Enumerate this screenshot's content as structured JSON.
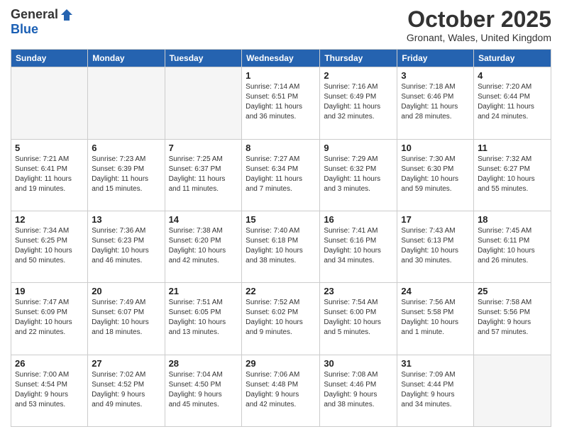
{
  "header": {
    "logo_general": "General",
    "logo_blue": "Blue",
    "month_title": "October 2025",
    "location": "Gronant, Wales, United Kingdom"
  },
  "days_of_week": [
    "Sunday",
    "Monday",
    "Tuesday",
    "Wednesday",
    "Thursday",
    "Friday",
    "Saturday"
  ],
  "weeks": [
    [
      {
        "day": "",
        "info": ""
      },
      {
        "day": "",
        "info": ""
      },
      {
        "day": "",
        "info": ""
      },
      {
        "day": "1",
        "info": "Sunrise: 7:14 AM\nSunset: 6:51 PM\nDaylight: 11 hours\nand 36 minutes."
      },
      {
        "day": "2",
        "info": "Sunrise: 7:16 AM\nSunset: 6:49 PM\nDaylight: 11 hours\nand 32 minutes."
      },
      {
        "day": "3",
        "info": "Sunrise: 7:18 AM\nSunset: 6:46 PM\nDaylight: 11 hours\nand 28 minutes."
      },
      {
        "day": "4",
        "info": "Sunrise: 7:20 AM\nSunset: 6:44 PM\nDaylight: 11 hours\nand 24 minutes."
      }
    ],
    [
      {
        "day": "5",
        "info": "Sunrise: 7:21 AM\nSunset: 6:41 PM\nDaylight: 11 hours\nand 19 minutes."
      },
      {
        "day": "6",
        "info": "Sunrise: 7:23 AM\nSunset: 6:39 PM\nDaylight: 11 hours\nand 15 minutes."
      },
      {
        "day": "7",
        "info": "Sunrise: 7:25 AM\nSunset: 6:37 PM\nDaylight: 11 hours\nand 11 minutes."
      },
      {
        "day": "8",
        "info": "Sunrise: 7:27 AM\nSunset: 6:34 PM\nDaylight: 11 hours\nand 7 minutes."
      },
      {
        "day": "9",
        "info": "Sunrise: 7:29 AM\nSunset: 6:32 PM\nDaylight: 11 hours\nand 3 minutes."
      },
      {
        "day": "10",
        "info": "Sunrise: 7:30 AM\nSunset: 6:30 PM\nDaylight: 10 hours\nand 59 minutes."
      },
      {
        "day": "11",
        "info": "Sunrise: 7:32 AM\nSunset: 6:27 PM\nDaylight: 10 hours\nand 55 minutes."
      }
    ],
    [
      {
        "day": "12",
        "info": "Sunrise: 7:34 AM\nSunset: 6:25 PM\nDaylight: 10 hours\nand 50 minutes."
      },
      {
        "day": "13",
        "info": "Sunrise: 7:36 AM\nSunset: 6:23 PM\nDaylight: 10 hours\nand 46 minutes."
      },
      {
        "day": "14",
        "info": "Sunrise: 7:38 AM\nSunset: 6:20 PM\nDaylight: 10 hours\nand 42 minutes."
      },
      {
        "day": "15",
        "info": "Sunrise: 7:40 AM\nSunset: 6:18 PM\nDaylight: 10 hours\nand 38 minutes."
      },
      {
        "day": "16",
        "info": "Sunrise: 7:41 AM\nSunset: 6:16 PM\nDaylight: 10 hours\nand 34 minutes."
      },
      {
        "day": "17",
        "info": "Sunrise: 7:43 AM\nSunset: 6:13 PM\nDaylight: 10 hours\nand 30 minutes."
      },
      {
        "day": "18",
        "info": "Sunrise: 7:45 AM\nSunset: 6:11 PM\nDaylight: 10 hours\nand 26 minutes."
      }
    ],
    [
      {
        "day": "19",
        "info": "Sunrise: 7:47 AM\nSunset: 6:09 PM\nDaylight: 10 hours\nand 22 minutes."
      },
      {
        "day": "20",
        "info": "Sunrise: 7:49 AM\nSunset: 6:07 PM\nDaylight: 10 hours\nand 18 minutes."
      },
      {
        "day": "21",
        "info": "Sunrise: 7:51 AM\nSunset: 6:05 PM\nDaylight: 10 hours\nand 13 minutes."
      },
      {
        "day": "22",
        "info": "Sunrise: 7:52 AM\nSunset: 6:02 PM\nDaylight: 10 hours\nand 9 minutes."
      },
      {
        "day": "23",
        "info": "Sunrise: 7:54 AM\nSunset: 6:00 PM\nDaylight: 10 hours\nand 5 minutes."
      },
      {
        "day": "24",
        "info": "Sunrise: 7:56 AM\nSunset: 5:58 PM\nDaylight: 10 hours\nand 1 minute."
      },
      {
        "day": "25",
        "info": "Sunrise: 7:58 AM\nSunset: 5:56 PM\nDaylight: 9 hours\nand 57 minutes."
      }
    ],
    [
      {
        "day": "26",
        "info": "Sunrise: 7:00 AM\nSunset: 4:54 PM\nDaylight: 9 hours\nand 53 minutes."
      },
      {
        "day": "27",
        "info": "Sunrise: 7:02 AM\nSunset: 4:52 PM\nDaylight: 9 hours\nand 49 minutes."
      },
      {
        "day": "28",
        "info": "Sunrise: 7:04 AM\nSunset: 4:50 PM\nDaylight: 9 hours\nand 45 minutes."
      },
      {
        "day": "29",
        "info": "Sunrise: 7:06 AM\nSunset: 4:48 PM\nDaylight: 9 hours\nand 42 minutes."
      },
      {
        "day": "30",
        "info": "Sunrise: 7:08 AM\nSunset: 4:46 PM\nDaylight: 9 hours\nand 38 minutes."
      },
      {
        "day": "31",
        "info": "Sunrise: 7:09 AM\nSunset: 4:44 PM\nDaylight: 9 hours\nand 34 minutes."
      },
      {
        "day": "",
        "info": ""
      }
    ]
  ]
}
